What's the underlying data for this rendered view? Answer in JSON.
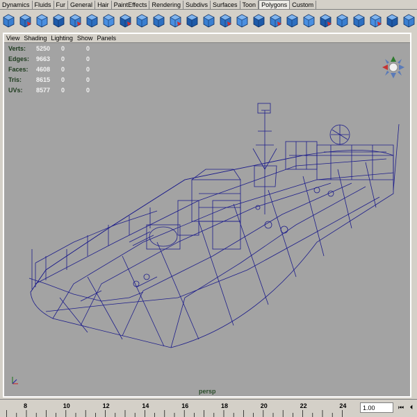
{
  "shelf_tabs": [
    "Dynamics",
    "Fluids",
    "Fur",
    "General",
    "Hair",
    "PaintEffects",
    "Rendering",
    "Subdivs",
    "Surfaces",
    "Toon",
    "Polygons",
    "Custom"
  ],
  "active_tab": "Polygons",
  "shelf_icons": [
    "create-cube-icon",
    "create-sphere-icon",
    "create-cylinder-icon",
    "create-plane-icon",
    "poly-cube-icon",
    "extrude-face-icon",
    "split-polygon-icon",
    "extrude-edge-icon",
    "bevel-icon",
    "merge-vertices-icon",
    "wedge-face-icon",
    "poke-face-icon",
    "smooth-icon",
    "reduce-icon",
    "triangulate-icon",
    "quadrangulate-icon",
    "combine-icon",
    "separate-icon",
    "uv-map-icon",
    "planar-mapping-icon",
    "cylindrical-mapping-icon",
    "spherical-mapping-icon",
    "automatic-mapping-icon",
    "uv-texture-editor-icon",
    "transfer-uv-icon",
    "layout-uv-icon"
  ],
  "panel_menu": [
    "View",
    "Shading",
    "Lighting",
    "Show",
    "Panels"
  ],
  "hud": [
    {
      "label": "Verts:",
      "v1": "5250",
      "v2": "0",
      "v3": "0"
    },
    {
      "label": "Edges:",
      "v1": "9663",
      "v2": "0",
      "v3": "0"
    },
    {
      "label": "Faces:",
      "v1": "4608",
      "v2": "0",
      "v3": "0"
    },
    {
      "label": "Tris:",
      "v1": "8615",
      "v2": "0",
      "v3": "0"
    },
    {
      "label": "UVs:",
      "v1": "8577",
      "v2": "0",
      "v3": "0"
    }
  ],
  "camera_label": "persp",
  "timeline_ticks": [
    "8",
    "10",
    "12",
    "14",
    "16",
    "18",
    "20",
    "22",
    "24"
  ],
  "current_frame": "1.00",
  "btn_prev_key": "⏮",
  "btn_prev_frame": "⏴",
  "colors": {
    "viewport_bg": "#a3a3a3",
    "wire": "#1c1c8a",
    "hud_label": "#1c3a1c"
  }
}
